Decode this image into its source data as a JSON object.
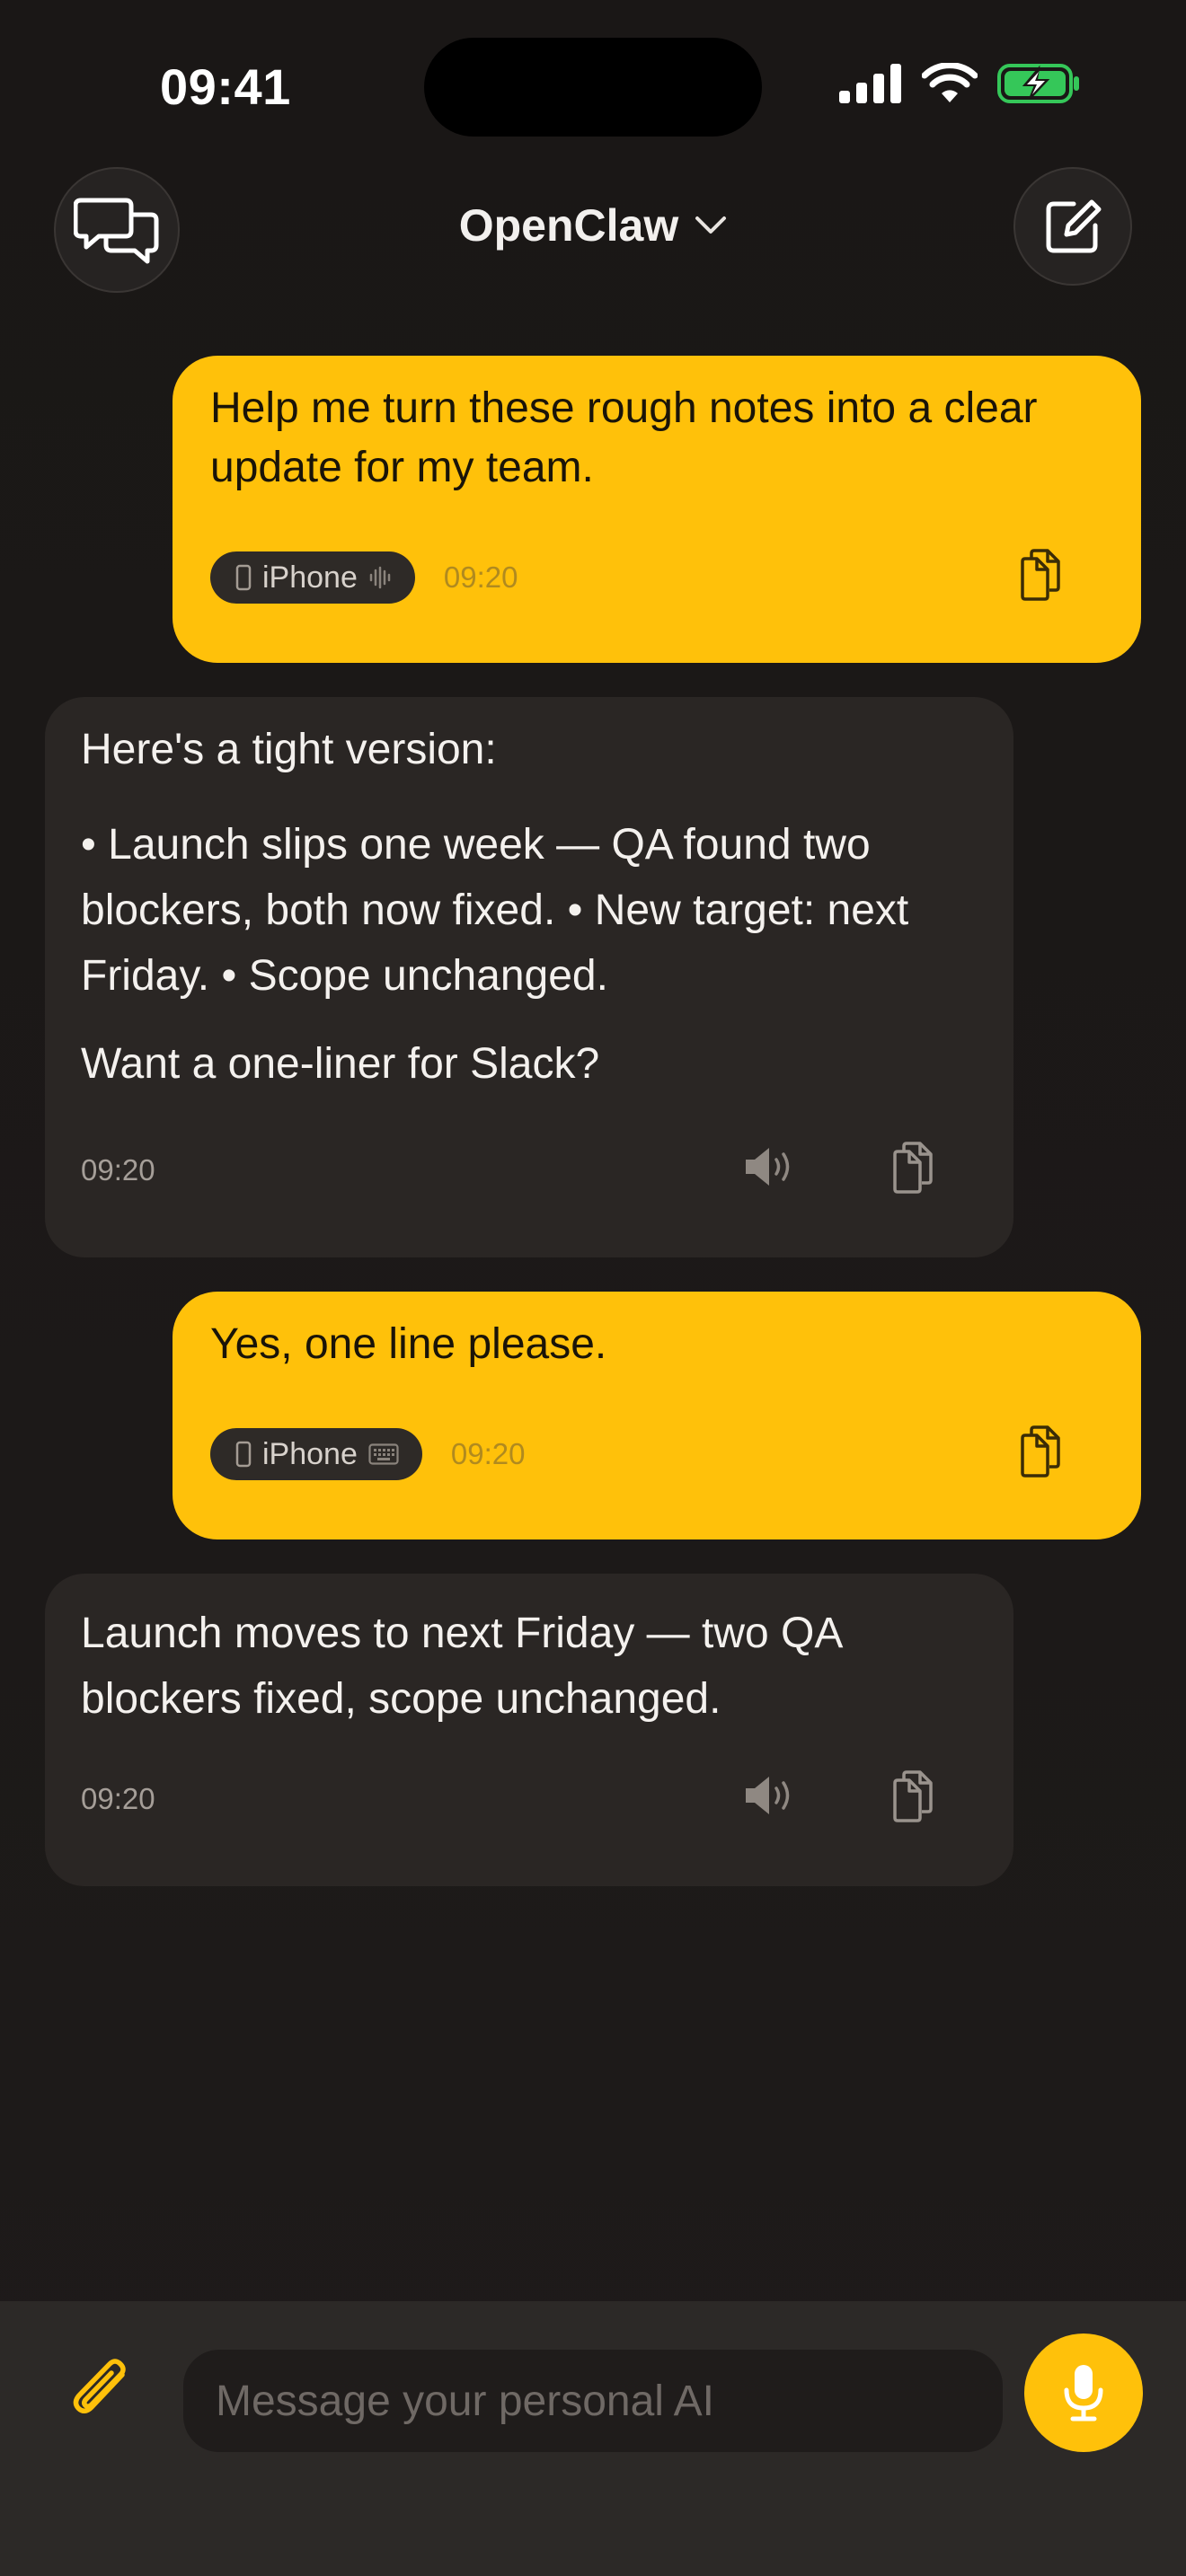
{
  "status_bar": {
    "time": "09:41"
  },
  "header": {
    "title": "OpenClaw"
  },
  "messages": [
    {
      "role": "user",
      "text": "Help me turn these rough notes into a clear update for my team.",
      "device": "iPhone",
      "input_mode": "voice",
      "time": "09:20"
    },
    {
      "role": "assistant",
      "paragraphs": [
        "Here's a tight version:",
        "• Launch slips one week — QA found two blockers, both now fixed. • New target: next Friday. • Scope unchanged.",
        "Want a one-liner for Slack?"
      ],
      "time": "09:20"
    },
    {
      "role": "user",
      "text": "Yes, one line please.",
      "device": "iPhone",
      "input_mode": "keyboard",
      "time": "09:20"
    },
    {
      "role": "assistant",
      "paragraphs": [
        "Launch moves to next Friday — two QA blockers fixed, scope unchanged."
      ],
      "time": "09:20"
    }
  ],
  "composer": {
    "placeholder": "Message your personal AI"
  },
  "colors": {
    "accent": "#ffc10a",
    "user_bubble": "#ffc10a",
    "assistant_bubble": "#2a2624",
    "battery_green": "#35c759"
  }
}
